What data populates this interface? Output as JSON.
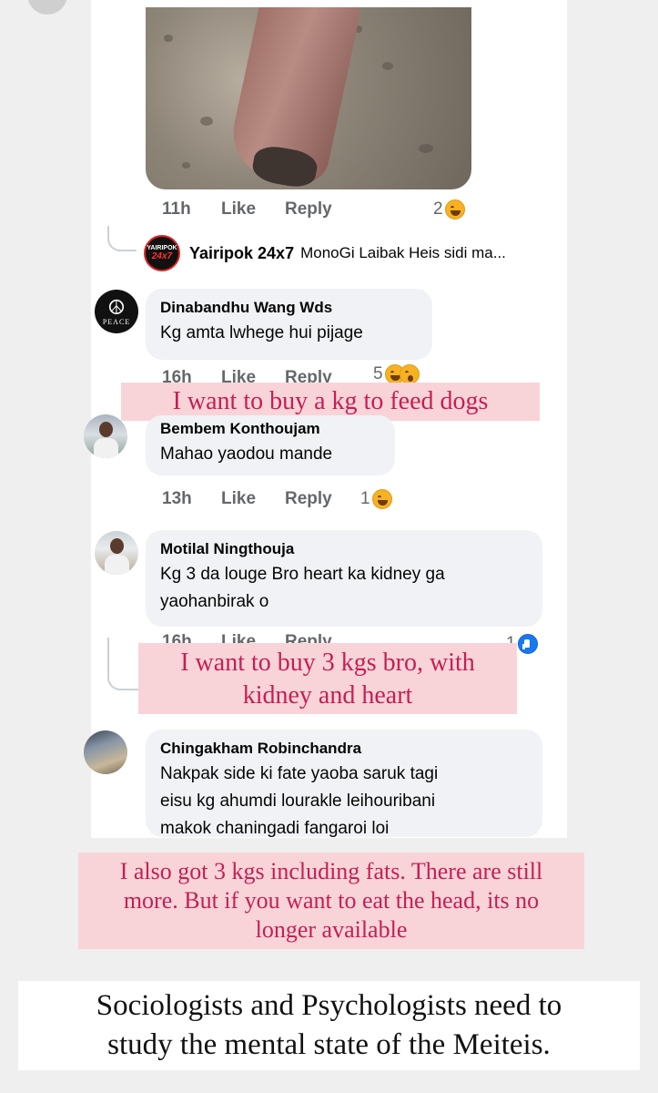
{
  "post_photo": {
    "alt": ""
  },
  "photo_meta": {
    "time": "11h",
    "like": "Like",
    "reply": "Reply",
    "reaction_count": "2"
  },
  "page_reply": {
    "logo_top": "YAIRIPOK",
    "logo_bottom": "24x7",
    "name": "Yairipok 24x7",
    "text": "MonoGi Laibak Heis sidi ma..."
  },
  "comments": [
    {
      "name": "Dinabandhu Wang Wds",
      "text": "Kg amta lwhege hui pijage",
      "time": "16h",
      "like": "Like",
      "reply": "Reply",
      "reaction_count": "5",
      "avatar_symbol": "☮",
      "avatar_word": "PEACE"
    },
    {
      "name": "Bembem Konthoujam",
      "text": "Mahao yaodou mande",
      "time": "13h",
      "like": "Like",
      "reply": "Reply",
      "reaction_count": "1"
    },
    {
      "name": "Motilal Ningthouja",
      "text_line1": "Kg 3 da louge Bro heart ka kidney ga",
      "text_line2": "yaohanbirak o",
      "time": "16h",
      "like": "Like",
      "reply": "Reply",
      "reaction_count": "1"
    },
    {
      "name": "Chingakham Robinchandra",
      "text_line1": "Nakpak side ki fate yaoba saruk tagi",
      "text_line2": "eisu kg ahumdi lourakle leihouribani",
      "text_line3": "makok chaningadi fangaroi loi"
    }
  ],
  "captions": {
    "dogs": "I want to buy a kg to feed dogs",
    "kidney_line1": "I want to buy 3 kgs bro, with",
    "kidney_line2": "kidney and heart",
    "fats_line1": "I also got 3 kgs including fats. There are still",
    "fats_line2": "more. But if you want to eat the head, its no",
    "fats_line3": "longer available"
  },
  "bottom_caption": {
    "line1": "Sociologists and Psychologists need to",
    "line2": "study the mental state of the Meiteis."
  },
  "colors": {
    "caption_bg": "#f8d4d9",
    "caption_text": "#c61e54",
    "facebook_blue": "#1877f2"
  }
}
